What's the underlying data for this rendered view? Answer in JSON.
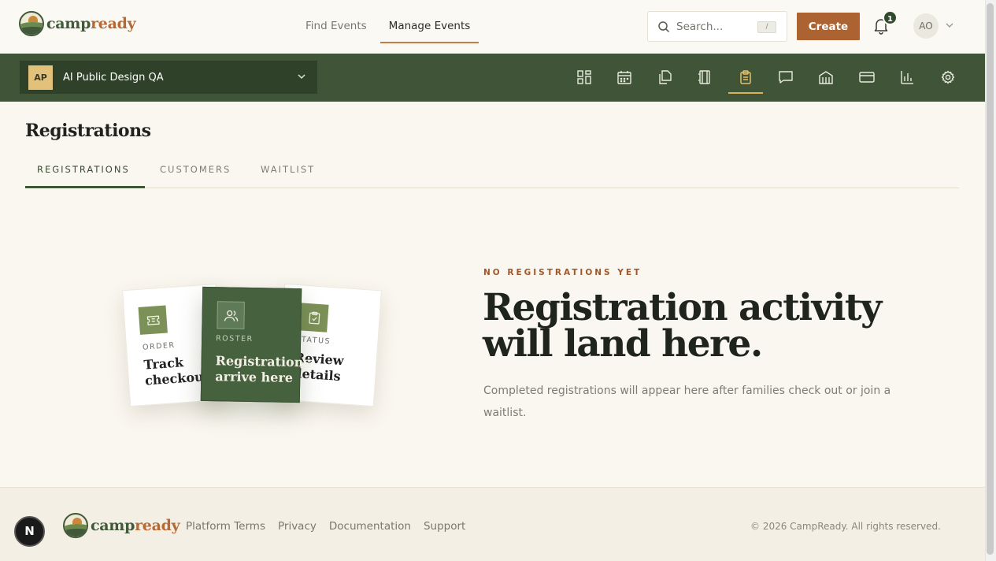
{
  "brand": {
    "name_part1": "camp",
    "name_part2": "ready"
  },
  "header": {
    "nav": [
      "Find Events",
      "Manage Events"
    ],
    "search_placeholder": "Search...",
    "search_shortcut": "/",
    "create_label": "Create",
    "notification_count": "1",
    "avatar_initials": "AO"
  },
  "toolbar": {
    "org_initials": "AP",
    "org_name": "AI Public Design QA",
    "tools": [
      "dashboard-icon",
      "calendar-icon",
      "copy-icon",
      "notebook-icon",
      "clipboard-icon",
      "message-icon",
      "building-icon",
      "credit-card-icon",
      "bar-chart-icon",
      "gear-icon"
    ],
    "active_tool": "clipboard-icon"
  },
  "page": {
    "title": "Registrations",
    "tabs": [
      "REGISTRATIONS",
      "CUSTOMERS",
      "WAITLIST"
    ],
    "active_tab": "REGISTRATIONS"
  },
  "illustration": {
    "cards": [
      {
        "label": "ORDER",
        "text": "Track checkout"
      },
      {
        "label": "ROSTER",
        "text": "Registrations arrive here"
      },
      {
        "label": "STATUS",
        "text": "Review details"
      }
    ]
  },
  "empty_state": {
    "eyebrow": "NO REGISTRATIONS YET",
    "headline": "Registration activity will land here.",
    "description": "Completed registrations will appear here after families check out or join a waitlist."
  },
  "footer": {
    "links": [
      "Platform Terms",
      "Privacy",
      "Documentation",
      "Support"
    ],
    "copyright": "© 2026 CampReady. All rights reserved.",
    "dev_badge": "N"
  },
  "colors": {
    "primary_green": "#405537",
    "accent_orange": "#ad6231",
    "background": "#faf7f0"
  }
}
